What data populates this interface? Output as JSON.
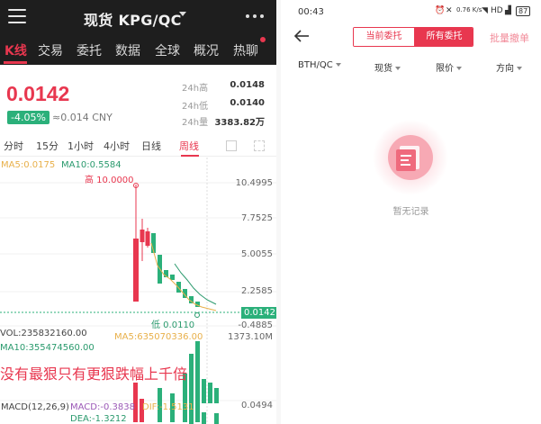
{
  "left": {
    "header": {
      "title": "现货 KPG/QC",
      "tabs": [
        {
          "label": "K线",
          "active": true
        },
        {
          "label": "交易",
          "active": false
        },
        {
          "label": "委托",
          "active": false
        },
        {
          "label": "数据",
          "active": false
        },
        {
          "label": "全球",
          "active": false
        },
        {
          "label": "概况",
          "active": false
        },
        {
          "label": "热聊",
          "active": false
        }
      ]
    },
    "ticker": {
      "last_price": "0.0142",
      "change": "-4.05%",
      "cny": "≈0.014 CNY",
      "stats": [
        {
          "label": "24h高",
          "value": "0.0148"
        },
        {
          "label": "24h低",
          "value": "0.0140"
        },
        {
          "label": "24h量",
          "value": "3383.82万"
        }
      ]
    },
    "periods": [
      {
        "label": "分时",
        "active": false
      },
      {
        "label": "15分",
        "active": false
      },
      {
        "label": "1小时",
        "active": false
      },
      {
        "label": "4小时",
        "active": false
      },
      {
        "label": "日线",
        "active": false
      },
      {
        "label": "周线",
        "active": true
      }
    ],
    "chart": {
      "ma5": "MA5:0.0175",
      "ma10": "MA10:0.5584",
      "high_annotation": "高 10.0000",
      "low_annotation": "低 0.0110",
      "y_ticks": [
        "10.4995",
        "7.7525",
        "5.0055",
        "2.2585",
        "-0.4885"
      ],
      "current_price_tag": "0.0142",
      "volume": "VOL:235832160.00",
      "vol_ma5": "MA5:635070336.00",
      "vol_ma10": "MA10:355474560.00",
      "vol_axis": "1373.10M",
      "overlay_text": "没有最狠只有更狠跌幅上千倍",
      "macd_label": "MACD(12,26,9)",
      "macd_value": "MACD:-0.3838",
      "dif_value": "DIF:-1.5131",
      "dea_value": "DEA:-1.3212",
      "macd_axis": "0.0494"
    },
    "colors": {
      "up": "#e8374f",
      "down": "#2bb07a",
      "ma5": "#e8b04a",
      "ma10": "#2a9a6d"
    }
  },
  "right": {
    "status_bar": {
      "time": "00:43",
      "network": "0.76 K/s",
      "hd": "HD",
      "battery": "87"
    },
    "segment": {
      "current": "当前委托",
      "all": "所有委托",
      "selected": "all"
    },
    "batch_cancel": "批量撤单",
    "filters": [
      {
        "label": "BTH/QC"
      },
      {
        "label": "现货"
      },
      {
        "label": "限价"
      },
      {
        "label": "方向"
      }
    ],
    "empty_text": "暂无记录"
  }
}
